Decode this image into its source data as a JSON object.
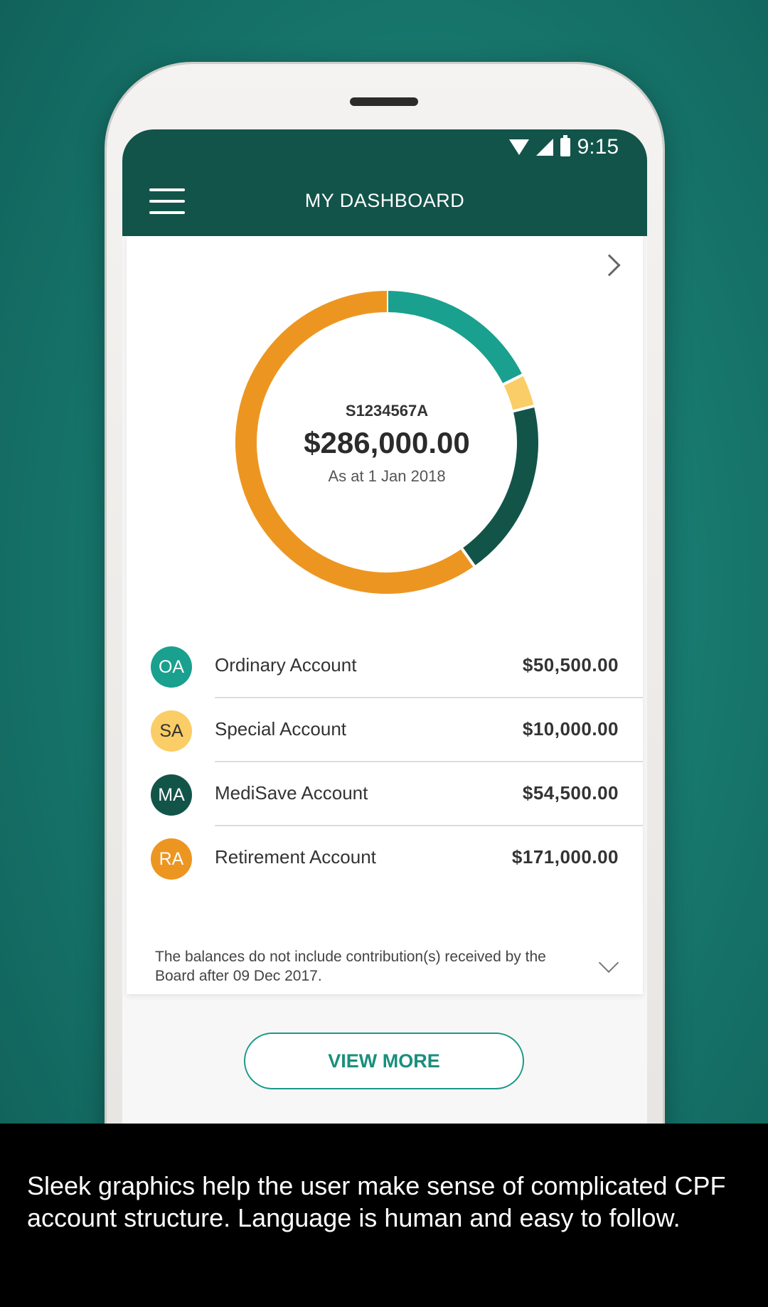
{
  "status_bar": {
    "time": "9:15",
    "icons": [
      "wifi-icon",
      "signal-icon",
      "battery-icon"
    ]
  },
  "app_bar": {
    "title": "MY DASHBOARD",
    "menu_icon": "hamburger-menu-icon"
  },
  "summary": {
    "account_id": "S1234567A",
    "total": "$286,000.00",
    "as_at": "As at 1 Jan 2018"
  },
  "accounts": [
    {
      "code": "OA",
      "name": "Ordinary Account",
      "amount": "$50,500.00",
      "value": 50500,
      "color": "#1aa08e",
      "text_color": "#ffffff"
    },
    {
      "code": "SA",
      "name": "Special Account",
      "amount": "$10,000.00",
      "value": 10000,
      "color": "#fbcd66",
      "text_color": "#333333"
    },
    {
      "code": "MA",
      "name": "MediSave Account",
      "amount": "$54,500.00",
      "value": 54500,
      "color": "#135449",
      "text_color": "#ffffff"
    },
    {
      "code": "RA",
      "name": "Retirement Account",
      "amount": "$171,000.00",
      "value": 171000,
      "color": "#ec9621",
      "text_color": "#ffffff"
    }
  ],
  "note": "The balances do not include contribution(s) received by the Board after 09 Dec 2017.",
  "view_more_label": "VIEW MORE",
  "caption": "Sleek graphics help the user make sense of complicated CPF account structure. Language is human and easy to follow.",
  "colors": {
    "primary": "#125449",
    "accent": "#1a9a85"
  }
}
